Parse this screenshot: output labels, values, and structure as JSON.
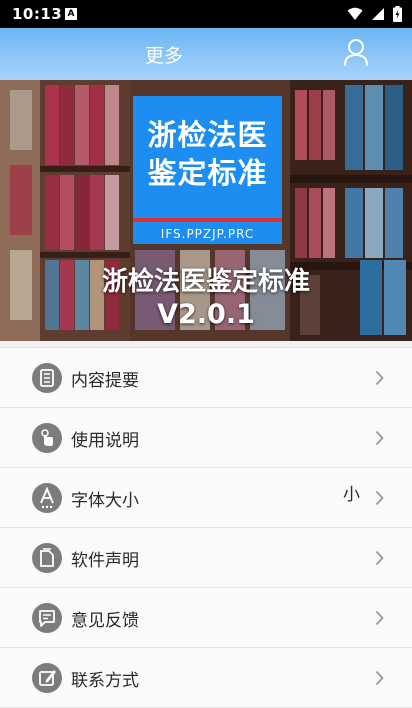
{
  "status_bar": {
    "time": "10:13",
    "notification_icon": "A"
  },
  "header": {
    "title": "更多",
    "user_icon": "user-icon"
  },
  "banner": {
    "logo_line1": "浙检法医",
    "logo_line2": "鉴定标准",
    "logo_url": "IFS.PPZJP.PRC",
    "app_name": "浙检法医鉴定标准",
    "version": "V2.0.1"
  },
  "menu": {
    "items": [
      {
        "label": "内容提要",
        "icon": "document-list-icon"
      },
      {
        "label": "使用说明",
        "icon": "hand-touch-icon"
      },
      {
        "label": "字体大小",
        "icon": "font-size-icon",
        "value": "小"
      },
      {
        "label": "软件声明",
        "icon": "file-icon"
      },
      {
        "label": "意见反馈",
        "icon": "message-icon"
      },
      {
        "label": "联系方式",
        "icon": "edit-icon"
      }
    ]
  }
}
